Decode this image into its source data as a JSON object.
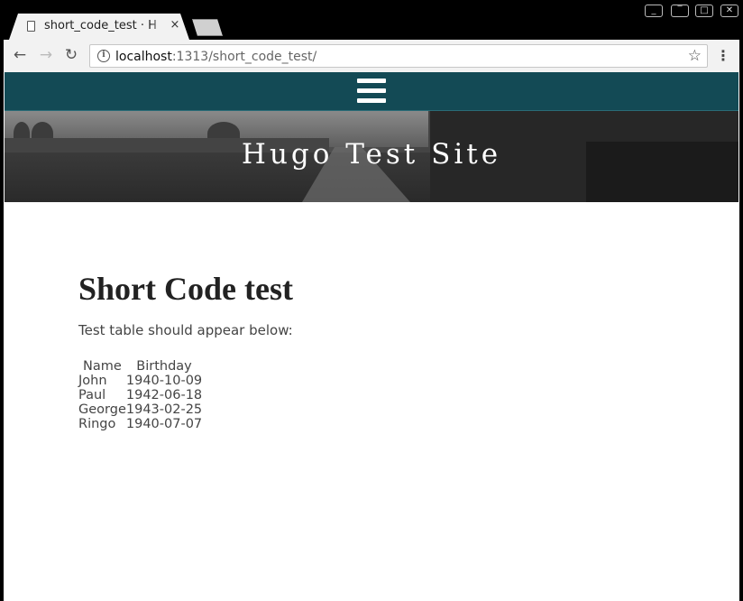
{
  "browser": {
    "tab": {
      "title": "short_code_test · H",
      "close_label": "×"
    },
    "url": {
      "host": "localhost",
      "path": ":1313/short_code_test/"
    },
    "nav": {
      "back": "←",
      "forward": "→",
      "reload": "↻"
    },
    "window_controls": [
      "_",
      "‾",
      "□",
      "✕"
    ],
    "icons": {
      "page": "page-icon",
      "info": "info-icon",
      "star": "bookmark-star-icon",
      "menu": "kebab-menu-icon",
      "info_glyph": "i",
      "star_glyph": "☆",
      "menu_glyph": "⋮"
    }
  },
  "site": {
    "title": "Hugo Test Site",
    "nav_color": "#134a55"
  },
  "page": {
    "heading": "Short Code test",
    "intro": "Test table should appear below:",
    "table": {
      "headers": [
        "Name",
        "Birthday"
      ],
      "rows": [
        [
          "John",
          "1940-10-09"
        ],
        [
          "Paul",
          "1942-06-18"
        ],
        [
          "George",
          "1943-02-25"
        ],
        [
          "Ringo",
          "1940-07-07"
        ]
      ]
    }
  }
}
